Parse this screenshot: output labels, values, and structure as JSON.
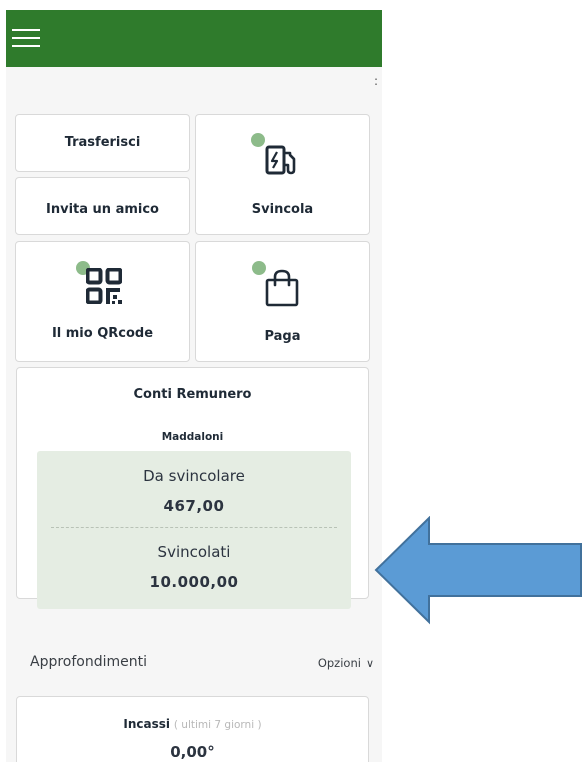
{
  "header": {
    "menu_icon": "hamburger-menu-icon",
    "background": "#2f7b2c"
  },
  "more_menu": {
    "label": ":"
  },
  "actions": {
    "trasferisci": "Trasferisci",
    "invita": "Invita un amico",
    "svincola": "Svincola",
    "qrcode": "Il mio QRcode",
    "paga": "Paga"
  },
  "account": {
    "title": "Conti Remunero",
    "subtitle": "Maddaloni",
    "da_svincolare_label": "Da svincolare",
    "da_svincolare_value": "467,00",
    "svincolati_label": "Svincolati",
    "svincolati_value": "10.000,00"
  },
  "section": {
    "title": "Approfondimenti",
    "options_label": "Opzioni",
    "options_icon": "chevron-down-icon"
  },
  "incassi": {
    "title": "Incassi",
    "period": "( ultimi 7 giorni )",
    "value": "0,00°"
  },
  "colors": {
    "accent_green": "#2f7b2c",
    "dot_green": "#8dbb8a",
    "summary_bg": "#e5ede3",
    "arrow_blue": "#5b9bd5"
  }
}
